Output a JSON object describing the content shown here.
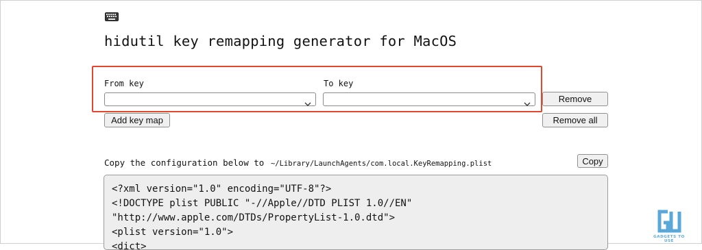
{
  "page": {
    "icon": "keyboard-icon",
    "title": "hidutil key remapping generator for MacOS"
  },
  "mapping": {
    "from_label": "From key",
    "to_label": "To key",
    "from_value": "",
    "to_value": "",
    "remove_label": "Remove",
    "highlight_color": "#e2462e"
  },
  "actions": {
    "add_label": "Add key map",
    "remove_all_label": "Remove all"
  },
  "config": {
    "instruction": "Copy the configuration below to",
    "path": "~/Library/LaunchAgents/com.local.KeyRemapping.plist",
    "copy_label": "Copy",
    "code_lines": [
      "<?xml version=\"1.0\" encoding=\"UTF-8\"?>",
      "<!DOCTYPE plist PUBLIC \"-//Apple//DTD PLIST 1.0//EN\"",
      "\"http://www.apple.com/DTDs/PropertyList-1.0.dtd\">",
      "<plist version=\"1.0\">",
      "<dict>"
    ]
  },
  "watermark": {
    "logo": "gadgets-to-use-logo",
    "text": "GADGETS TO USE",
    "color": "#5aa8d8"
  }
}
